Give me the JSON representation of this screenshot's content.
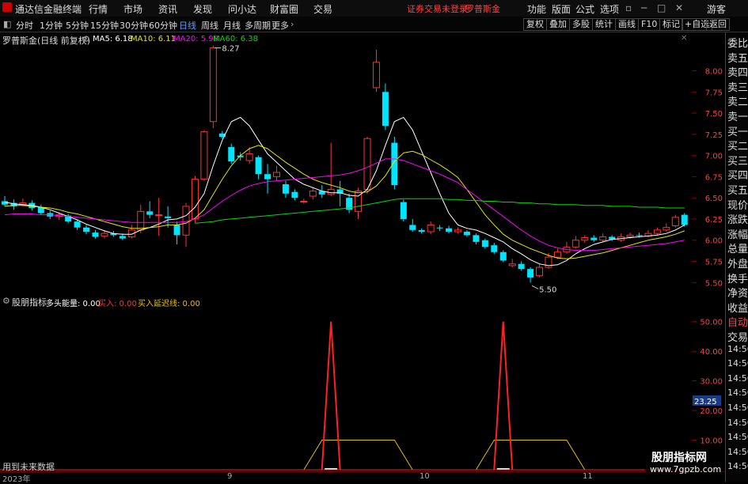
{
  "app": {
    "title": "通达信金融终端",
    "menu": [
      "行情",
      "市场",
      "资讯",
      "发现",
      "问小达",
      "财富圈",
      "交易"
    ],
    "status_notice": "证券交易未登录",
    "stock_name": "罗普斯金",
    "right_menu": [
      "功能",
      "版面",
      "公式",
      "选项"
    ],
    "guest": "游客",
    "window_controls": [
      "restore-icon",
      "minimize-icon",
      "maximize-icon",
      "close-icon"
    ]
  },
  "toolbar": {
    "periods": [
      "分时",
      "1分钟",
      "5分钟",
      "15分钟",
      "30分钟",
      "60分钟",
      "日线",
      "周线",
      "月线",
      "多周期",
      "更多"
    ],
    "active_period": "日线",
    "buttons": [
      "复权",
      "叠加",
      "多股",
      "统计",
      "画线",
      "F10",
      "标记",
      "+自选",
      "返回"
    ]
  },
  "main_chart": {
    "title": "罗普斯金(日线 前复权)",
    "ma_labels": [
      {
        "text": "MA5: 6.18",
        "color": "#ffffff"
      },
      {
        "text": "MA10: 6.11",
        "color": "#e6e600"
      },
      {
        "text": "MA20: 5.98",
        "color": "#ff00ff"
      },
      {
        "text": "MA60: 6.38",
        "color": "#00dd00"
      }
    ],
    "high_label": "8.27",
    "low_label": "5.50",
    "y_ticks": [
      "8.00",
      "7.75",
      "7.50",
      "7.25",
      "7.00",
      "6.75",
      "6.50",
      "6.25",
      "6.00",
      "5.75",
      "5.50"
    ]
  },
  "sub_chart": {
    "title": "股朋指标",
    "metrics": [
      {
        "text": "多头能量: 0.00",
        "color": "#ffffff"
      },
      {
        "text": "买入: 0.00",
        "color": "#ff3030"
      },
      {
        "text": "买入延迟线: 0.00",
        "color": "#e6c000"
      }
    ],
    "y_ticks": [
      "50.00",
      "40.00",
      "30.00",
      "20.00",
      "10.00"
    ],
    "current_value": "23.25",
    "footer_note": "用到未来数据"
  },
  "date_axis": [
    "2023年",
    "9",
    "10",
    "11"
  ],
  "side_panel": {
    "items": [
      "委比",
      "卖五",
      "卖四",
      "卖三",
      "卖二",
      "卖一",
      "买一",
      "买二",
      "买三",
      "买四",
      "买五",
      "现价",
      "涨跌",
      "涨幅",
      "总量",
      "外盘",
      "换手",
      "净资",
      "收益",
      "自动",
      "交易",
      "14:56",
      "14:56",
      "14:56",
      "14:56",
      "14:56",
      "14:56",
      "14:56",
      "14:56",
      "14:56"
    ]
  },
  "watermark": {
    "line1": "股朋指标网",
    "line2": "www.7gpzb.com"
  },
  "chart_data": {
    "type": "candlestick",
    "title": "罗普斯金(日线 前复权)",
    "ylim": [
      5.4,
      8.35
    ],
    "candles": [
      {
        "o": 6.46,
        "c": 6.42,
        "h": 6.52,
        "l": 6.4
      },
      {
        "o": 6.44,
        "c": 6.4,
        "h": 6.48,
        "l": 6.36
      },
      {
        "o": 6.42,
        "c": 6.44,
        "h": 6.49,
        "l": 6.4
      },
      {
        "o": 6.44,
        "c": 6.38,
        "h": 6.47,
        "l": 6.35
      },
      {
        "o": 6.39,
        "c": 6.32,
        "h": 6.42,
        "l": 6.3
      },
      {
        "o": 6.32,
        "c": 6.28,
        "h": 6.35,
        "l": 6.25
      },
      {
        "o": 6.28,
        "c": 6.3,
        "h": 6.33,
        "l": 6.24
      },
      {
        "o": 6.29,
        "c": 6.22,
        "h": 6.31,
        "l": 6.2
      },
      {
        "o": 6.22,
        "c": 6.15,
        "h": 6.24,
        "l": 6.12
      },
      {
        "o": 6.15,
        "c": 6.1,
        "h": 6.18,
        "l": 6.07
      },
      {
        "o": 6.09,
        "c": 6.04,
        "h": 6.12,
        "l": 6.02
      },
      {
        "o": 6.05,
        "c": 6.08,
        "h": 6.12,
        "l": 6.02
      },
      {
        "o": 6.08,
        "c": 6.06,
        "h": 6.11,
        "l": 6.04
      },
      {
        "o": 6.05,
        "c": 6.02,
        "h": 6.08,
        "l": 6.0
      },
      {
        "o": 6.04,
        "c": 6.12,
        "h": 6.18,
        "l": 6.02
      },
      {
        "o": 6.12,
        "c": 6.34,
        "h": 6.42,
        "l": 6.08
      },
      {
        "o": 6.34,
        "c": 6.3,
        "h": 6.46,
        "l": 6.26
      },
      {
        "o": 6.3,
        "c": 6.3,
        "h": 6.5,
        "l": 6.05
      },
      {
        "o": 6.28,
        "c": 6.26,
        "h": 6.4,
        "l": 6.15
      },
      {
        "o": 6.18,
        "c": 6.06,
        "h": 6.22,
        "l": 5.95
      },
      {
        "o": 6.06,
        "c": 6.4,
        "h": 6.44,
        "l": 5.92
      },
      {
        "o": 6.25,
        "c": 6.72,
        "h": 6.76,
        "l": 6.2
      },
      {
        "o": 6.72,
        "c": 7.28,
        "h": 7.3,
        "l": 6.7
      },
      {
        "o": 7.4,
        "c": 8.27,
        "h": 8.3,
        "l": 7.32
      },
      {
        "o": 7.26,
        "c": 7.22,
        "h": 7.29,
        "l": 7.2
      },
      {
        "o": 7.1,
        "c": 6.93,
        "h": 7.14,
        "l": 6.9
      },
      {
        "o": 7.0,
        "c": 6.98,
        "h": 7.04,
        "l": 6.94
      },
      {
        "o": 6.94,
        "c": 7.02,
        "h": 7.1,
        "l": 6.9
      },
      {
        "o": 6.98,
        "c": 6.78,
        "h": 7.0,
        "l": 6.72
      },
      {
        "o": 6.78,
        "c": 6.72,
        "h": 6.9,
        "l": 6.55
      },
      {
        "o": 6.75,
        "c": 6.8,
        "h": 6.88,
        "l": 6.7
      },
      {
        "o": 6.66,
        "c": 6.55,
        "h": 6.7,
        "l": 6.5
      },
      {
        "o": 6.57,
        "c": 6.5,
        "h": 6.6,
        "l": 6.47
      },
      {
        "o": 6.46,
        "c": 6.46,
        "h": 6.49,
        "l": 6.43
      },
      {
        "o": 6.52,
        "c": 6.58,
        "h": 6.63,
        "l": 6.48
      },
      {
        "o": 6.58,
        "c": 6.54,
        "h": 6.65,
        "l": 6.5
      },
      {
        "o": 6.54,
        "c": 6.6,
        "h": 7.15,
        "l": 6.52
      },
      {
        "o": 6.6,
        "c": 6.55,
        "h": 6.7,
        "l": 6.4
      },
      {
        "o": 6.5,
        "c": 6.36,
        "h": 6.55,
        "l": 6.32
      },
      {
        "o": 6.34,
        "c": 6.58,
        "h": 6.62,
        "l": 6.25
      },
      {
        "o": 6.6,
        "c": 7.2,
        "h": 7.22,
        "l": 6.55
      },
      {
        "o": 7.8,
        "c": 8.1,
        "h": 8.25,
        "l": 7.75
      },
      {
        "o": 7.75,
        "c": 7.35,
        "h": 7.85,
        "l": 7.3
      },
      {
        "o": 7.15,
        "c": 6.65,
        "h": 7.22,
        "l": 6.6
      },
      {
        "o": 6.45,
        "c": 6.25,
        "h": 6.48,
        "l": 6.22
      },
      {
        "o": 6.18,
        "c": 6.12,
        "h": 6.25,
        "l": 6.1
      },
      {
        "o": 6.12,
        "c": 6.1,
        "h": 6.14,
        "l": 6.08
      },
      {
        "o": 6.1,
        "c": 6.18,
        "h": 6.22,
        "l": 6.07
      },
      {
        "o": 6.15,
        "c": 6.14,
        "h": 6.18,
        "l": 6.11
      },
      {
        "o": 6.14,
        "c": 6.1,
        "h": 6.17,
        "l": 6.08
      },
      {
        "o": 6.1,
        "c": 6.12,
        "h": 6.15,
        "l": 6.08
      },
      {
        "o": 6.1,
        "c": 6.06,
        "h": 6.12,
        "l": 6.04
      },
      {
        "o": 6.06,
        "c": 5.98,
        "h": 6.08,
        "l": 5.95
      },
      {
        "o": 6.0,
        "c": 5.92,
        "h": 6.02,
        "l": 5.9
      },
      {
        "o": 5.94,
        "c": 5.86,
        "h": 5.97,
        "l": 5.84
      },
      {
        "o": 5.86,
        "c": 5.76,
        "h": 5.88,
        "l": 5.74
      },
      {
        "o": 5.7,
        "c": 5.72,
        "h": 5.78,
        "l": 5.68
      },
      {
        "o": 5.72,
        "c": 5.66,
        "h": 5.75,
        "l": 5.64
      },
      {
        "o": 5.66,
        "c": 5.56,
        "h": 5.68,
        "l": 5.5
      },
      {
        "o": 5.58,
        "c": 5.68,
        "h": 5.72,
        "l": 5.56
      },
      {
        "o": 5.68,
        "c": 5.8,
        "h": 5.85,
        "l": 5.66
      },
      {
        "o": 5.8,
        "c": 5.86,
        "h": 5.9,
        "l": 5.78
      },
      {
        "o": 5.86,
        "c": 5.92,
        "h": 5.98,
        "l": 5.84
      },
      {
        "o": 5.92,
        "c": 6.0,
        "h": 6.05,
        "l": 5.9
      },
      {
        "o": 6.0,
        "c": 6.03,
        "h": 6.06,
        "l": 5.97
      },
      {
        "o": 6.03,
        "c": 6.0,
        "h": 6.06,
        "l": 5.98
      },
      {
        "o": 6.0,
        "c": 6.04,
        "h": 6.08,
        "l": 5.98
      },
      {
        "o": 6.04,
        "c": 6.01,
        "h": 6.06,
        "l": 5.99
      },
      {
        "o": 6.0,
        "c": 6.04,
        "h": 6.08,
        "l": 5.98
      },
      {
        "o": 6.04,
        "c": 6.06,
        "h": 6.09,
        "l": 6.02
      },
      {
        "o": 6.06,
        "c": 6.05,
        "h": 6.09,
        "l": 6.03
      },
      {
        "o": 6.05,
        "c": 6.08,
        "h": 6.12,
        "l": 6.03
      },
      {
        "o": 6.08,
        "c": 6.12,
        "h": 6.15,
        "l": 6.06
      },
      {
        "o": 6.12,
        "c": 6.15,
        "h": 6.2,
        "l": 6.1
      },
      {
        "o": 6.17,
        "c": 6.27,
        "h": 6.3,
        "l": 6.15
      },
      {
        "o": 6.3,
        "c": 6.18,
        "h": 6.32,
        "l": 6.16
      }
    ],
    "ma_lines": [
      {
        "name": "MA5",
        "color": "#ffffff",
        "values": [
          6.45,
          6.43,
          6.42,
          6.41,
          6.39,
          6.36,
          6.32,
          6.28,
          6.24,
          6.19,
          6.15,
          6.11,
          6.08,
          6.07,
          6.07,
          6.12,
          6.15,
          6.19,
          6.24,
          6.25,
          6.29,
          6.39,
          6.55,
          6.88,
          7.18,
          7.4,
          7.45,
          7.35,
          7.18,
          7.02,
          6.92,
          6.82,
          6.72,
          6.66,
          6.62,
          6.58,
          6.56,
          6.56,
          6.53,
          6.52,
          6.6,
          6.82,
          7.12,
          7.4,
          7.45,
          7.3,
          7.05,
          6.8,
          6.55,
          6.32,
          6.18,
          6.14,
          6.12,
          6.08,
          6.03,
          5.98,
          5.9,
          5.84,
          5.77,
          5.72,
          5.7,
          5.71,
          5.76,
          5.84,
          5.9,
          5.95,
          5.98,
          6.01,
          6.02,
          6.03,
          6.04,
          6.05,
          6.06,
          6.08,
          6.12,
          6.18
        ]
      },
      {
        "name": "MA10",
        "color": "#e6e600",
        "values": [
          6.4,
          6.41,
          6.41,
          6.4,
          6.39,
          6.38,
          6.36,
          6.33,
          6.31,
          6.28,
          6.25,
          6.22,
          6.19,
          6.16,
          6.14,
          6.14,
          6.15,
          6.16,
          6.18,
          6.18,
          6.2,
          6.26,
          6.36,
          6.54,
          6.72,
          6.88,
          7.0,
          7.08,
          7.12,
          7.08,
          7.0,
          6.92,
          6.85,
          6.78,
          6.72,
          6.68,
          6.65,
          6.62,
          6.58,
          6.56,
          6.57,
          6.64,
          6.76,
          6.93,
          7.03,
          7.05,
          7.01,
          6.95,
          6.89,
          6.82,
          6.74,
          6.6,
          6.45,
          6.3,
          6.18,
          6.07,
          6.0,
          5.95,
          5.9,
          5.86,
          5.82,
          5.79,
          5.78,
          5.79,
          5.81,
          5.83,
          5.85,
          5.88,
          5.91,
          5.94,
          5.97,
          6.0,
          6.02,
          6.04,
          6.07,
          6.11
        ]
      },
      {
        "name": "MA20",
        "color": "#ff00ff",
        "values": [
          6.3,
          6.31,
          6.31,
          6.31,
          6.3,
          6.3,
          6.29,
          6.28,
          6.27,
          6.26,
          6.25,
          6.24,
          6.23,
          6.22,
          6.21,
          6.21,
          6.21,
          6.21,
          6.21,
          6.21,
          6.22,
          6.25,
          6.3,
          6.38,
          6.46,
          6.53,
          6.59,
          6.64,
          6.67,
          6.69,
          6.7,
          6.71,
          6.72,
          6.73,
          6.74,
          6.75,
          6.76,
          6.77,
          6.79,
          6.82,
          6.86,
          6.91,
          6.96,
          6.96,
          6.94,
          6.9,
          6.86,
          6.82,
          6.78,
          6.73,
          6.68,
          6.6,
          6.52,
          6.44,
          6.36,
          6.28,
          6.2,
          6.12,
          6.05,
          5.99,
          5.94,
          5.91,
          5.89,
          5.88,
          5.88,
          5.88,
          5.89,
          5.9,
          5.91,
          5.92,
          5.93,
          5.94,
          5.95,
          5.96,
          5.98,
          6.0
        ]
      },
      {
        "name": "MA60",
        "color": "#00dd00",
        "values": [
          null,
          null,
          null,
          null,
          null,
          null,
          null,
          null,
          null,
          null,
          null,
          null,
          null,
          null,
          null,
          null,
          null,
          null,
          null,
          null,
          null,
          6.2,
          6.21,
          6.22,
          6.24,
          6.25,
          6.26,
          6.27,
          6.28,
          6.29,
          6.3,
          6.31,
          6.32,
          6.33,
          6.34,
          6.35,
          6.36,
          6.37,
          6.38,
          6.4,
          6.42,
          6.44,
          6.46,
          6.48,
          6.49,
          6.49,
          6.49,
          6.49,
          6.49,
          6.48,
          6.48,
          6.47,
          6.47,
          6.46,
          6.46,
          6.45,
          6.45,
          6.44,
          6.44,
          6.43,
          6.43,
          6.42,
          6.42,
          6.42,
          6.41,
          6.41,
          6.41,
          6.4,
          6.4,
          6.4,
          6.39,
          6.39,
          6.39,
          6.38,
          6.38,
          6.38
        ]
      }
    ],
    "indicator": {
      "ylim": [
        0,
        55
      ],
      "buy_spikes": [
        {
          "index": 36,
          "value": 50
        },
        {
          "index": 55,
          "value": 50
        }
      ],
      "delay_plateaus": [
        {
          "start": 35,
          "end": 43,
          "value": 10
        },
        {
          "start": 54,
          "end": 62,
          "value": 10
        }
      ],
      "colors": {
        "buy": "#ff2020",
        "delay": "#e6c000"
      }
    }
  }
}
